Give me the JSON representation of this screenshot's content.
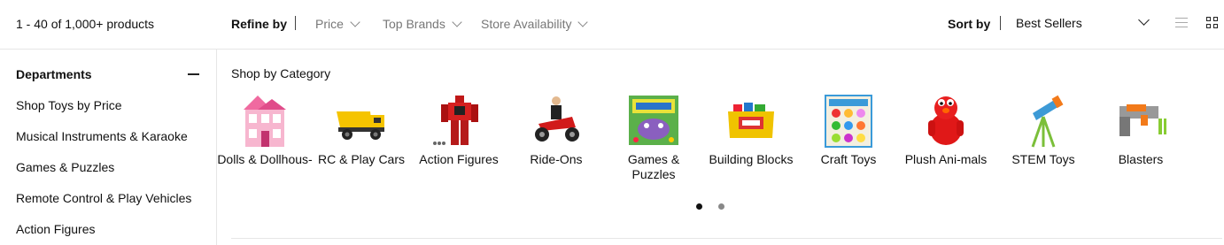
{
  "results": {
    "count_text": "1 - 40 of 1,000+ products"
  },
  "refine": {
    "label": "Refine by",
    "filters": [
      "Price",
      "Top Brands",
      "Store Availability"
    ]
  },
  "sort": {
    "label": "Sort by",
    "value": "Best Sellers"
  },
  "sidebar": {
    "title": "Departments",
    "items": [
      "Shop Toys by Price",
      "Musical Instruments & Karaoke",
      "Games & Puzzles",
      "Remote Control & Play Vehicles",
      "Action Figures"
    ]
  },
  "categories": {
    "heading": "Shop by Category",
    "items": [
      {
        "label": "Dolls & Dollhous-",
        "icon": "dollhouse-icon"
      },
      {
        "label": "RC & Play Cars",
        "icon": "dump-truck-icon"
      },
      {
        "label": "Action Figures",
        "icon": "robot-figure-icon"
      },
      {
        "label": "Ride-Ons",
        "icon": "ride-on-motorcycle-icon"
      },
      {
        "label": "Games & Puzzles",
        "icon": "board-game-box-icon"
      },
      {
        "label": "Building Blocks",
        "icon": "building-blocks-bin-icon"
      },
      {
        "label": "Craft Toys",
        "icon": "play-dough-set-icon"
      },
      {
        "label": "Plush Ani-mals",
        "icon": "plush-elmo-icon"
      },
      {
        "label": "STEM Toys",
        "icon": "telescope-icon"
      },
      {
        "label": "Blasters",
        "icon": "toy-blaster-icon"
      }
    ],
    "carousel_pages": 2,
    "carousel_active": 1
  },
  "colors": {
    "divider": "#e6e6e6",
    "muted_text": "#777777"
  }
}
